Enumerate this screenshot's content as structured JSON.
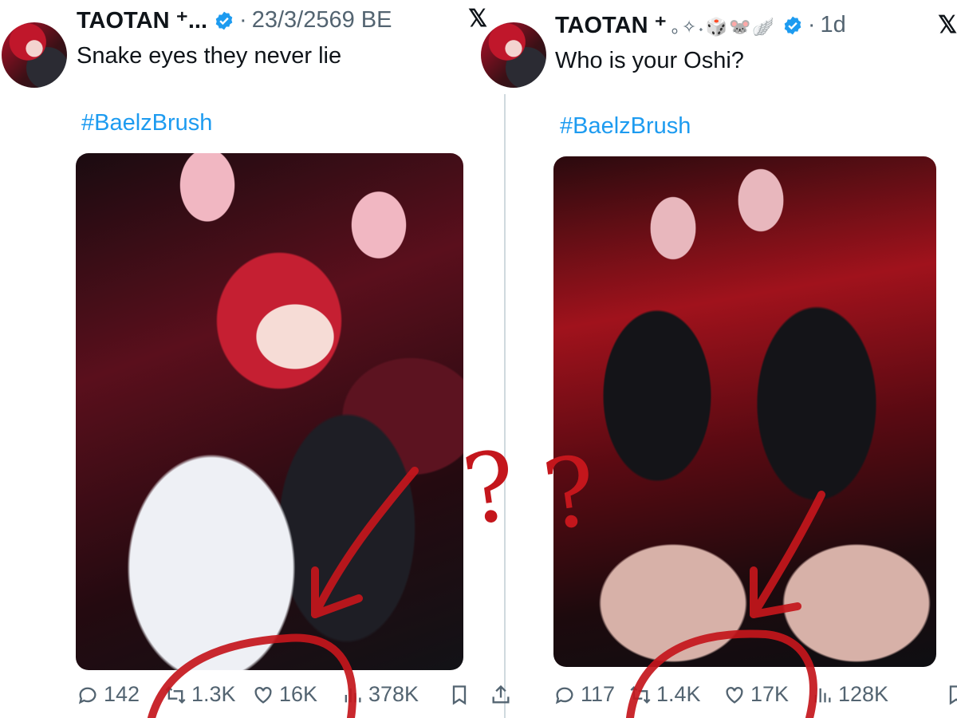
{
  "left_tweet": {
    "author_name": "TAOTAN ⁺...",
    "timestamp": "23/3/2569 BE",
    "separator": "·",
    "text": "Snake eyes they never lie",
    "hashtag": "#BaelzBrush",
    "replies": "142",
    "reposts": "1.3K",
    "likes": "16K",
    "views": "378K"
  },
  "right_tweet": {
    "author_name": "TAOTAN ⁺",
    "name_emojis": "｡✧˖🎲🐭🪽",
    "timestamp": "1d",
    "separator": "·",
    "text": "Who is your Oshi?",
    "hashtag": "#BaelzBrush",
    "replies": "117",
    "reposts": "1.4K",
    "likes": "17K",
    "views": "128K"
  },
  "annotations": {
    "left_question": "?",
    "right_question": "?",
    "ink_color": "#c4161c"
  },
  "colors": {
    "link": "#1d9bf0",
    "muted": "#536471",
    "verified": "#1d9bf0"
  },
  "icons": [
    "reply-icon",
    "repost-icon",
    "like-icon",
    "views-icon",
    "bookmark-icon",
    "share-icon",
    "verified-icon",
    "x-logo-icon"
  ]
}
